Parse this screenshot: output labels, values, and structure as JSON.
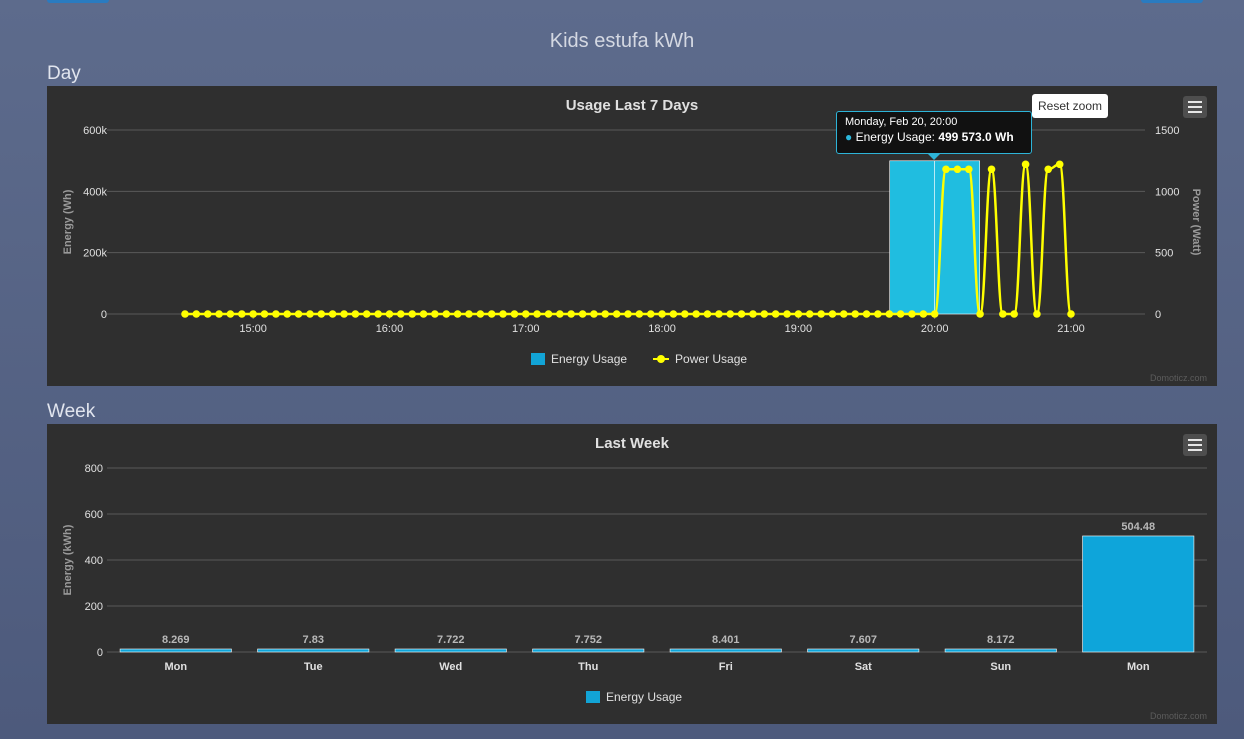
{
  "page": {
    "title": "Kids estufa kWh"
  },
  "day": {
    "section_label": "Day",
    "reset_zoom_label": "Reset zoom",
    "tooltip": {
      "title": "Monday, Feb 20, 20:00",
      "series": "Energy Usage",
      "value": "499 573.0 Wh"
    },
    "credit": "Domoticz.com"
  },
  "week": {
    "section_label": "Week",
    "credit": "Domoticz.com"
  },
  "colors": {
    "energy": "#12a4d6",
    "power": "#ffff00",
    "panel_bg": "#2f2f2f"
  },
  "icons": {
    "menu": "hamburger-menu-icon"
  },
  "chart_data": [
    {
      "type": "bar",
      "title": "Usage Last 7 Days",
      "xlabel": "",
      "ylabel": "Energy (Wh)",
      "ylabel_right": "Power (Watt)",
      "x_ticks": [
        "15:00",
        "16:00",
        "17:00",
        "18:00",
        "19:00",
        "20:00",
        "21:00"
      ],
      "y_ticks": [
        "0",
        "200k",
        "400k",
        "600k"
      ],
      "ylim": [
        0,
        600000
      ],
      "y2_ticks": [
        "0",
        "500",
        "1000",
        "1500"
      ],
      "y2lim": [
        0,
        1500
      ],
      "xlim_hours": [
        14.5,
        21.0
      ],
      "grid": true,
      "legend": "bottom-center",
      "series": [
        {
          "name": "Energy Usage",
          "type": "column",
          "axis": "left",
          "points": [
            [
              19.67,
              499573
            ],
            [
              20.0,
              499573
            ]
          ]
        },
        {
          "name": "Power Usage",
          "type": "line",
          "axis": "right",
          "x": [
            14.5,
            14.583,
            14.667,
            14.75,
            14.833,
            14.917,
            15.0,
            15.083,
            15.167,
            15.25,
            15.333,
            15.417,
            15.5,
            15.583,
            15.667,
            15.75,
            15.833,
            15.917,
            16.0,
            16.083,
            16.167,
            16.25,
            16.333,
            16.417,
            16.5,
            16.583,
            16.667,
            16.75,
            16.833,
            16.917,
            17.0,
            17.083,
            17.167,
            17.25,
            17.333,
            17.417,
            17.5,
            17.583,
            17.667,
            17.75,
            17.833,
            17.917,
            18.0,
            18.083,
            18.167,
            18.25,
            18.333,
            18.417,
            18.5,
            18.583,
            18.667,
            18.75,
            18.833,
            18.917,
            19.0,
            19.083,
            19.167,
            19.25,
            19.333,
            19.417,
            19.5,
            19.583,
            19.667,
            19.75,
            19.833,
            19.917,
            20.0,
            20.083,
            20.167,
            20.25,
            20.333,
            20.417,
            20.5,
            20.583,
            20.667,
            20.75,
            20.833,
            20.917,
            21.0
          ],
          "y": [
            0,
            0,
            0,
            0,
            0,
            0,
            0,
            0,
            0,
            0,
            0,
            0,
            0,
            0,
            0,
            0,
            0,
            0,
            0,
            0,
            0,
            0,
            0,
            0,
            0,
            0,
            0,
            0,
            0,
            0,
            0,
            0,
            0,
            0,
            0,
            0,
            0,
            0,
            0,
            0,
            0,
            0,
            0,
            0,
            0,
            0,
            0,
            0,
            0,
            0,
            0,
            0,
            0,
            0,
            0,
            0,
            0,
            0,
            0,
            0,
            0,
            0,
            0,
            0,
            0,
            0,
            0,
            1180,
            1180,
            1180,
            0,
            1180,
            0,
            0,
            1220,
            0,
            1180,
            1220,
            0
          ]
        }
      ]
    },
    {
      "type": "bar",
      "title": "Last Week",
      "xlabel": "",
      "ylabel": "Energy (kWh)",
      "categories": [
        "Mon",
        "Tue",
        "Wed",
        "Thu",
        "Fri",
        "Sat",
        "Sun",
        "Mon"
      ],
      "y_ticks": [
        "0",
        "200",
        "400",
        "600",
        "800"
      ],
      "ylim": [
        0,
        800
      ],
      "grid": true,
      "legend": "bottom-center",
      "series": [
        {
          "name": "Energy Usage",
          "values": [
            8.269,
            7.83,
            7.722,
            7.752,
            8.401,
            7.607,
            8.172,
            504.48
          ],
          "labels": [
            "8.269",
            "7.83",
            "7.722",
            "7.752",
            "8.401",
            "7.607",
            "8.172",
            "504.48"
          ]
        }
      ]
    }
  ]
}
